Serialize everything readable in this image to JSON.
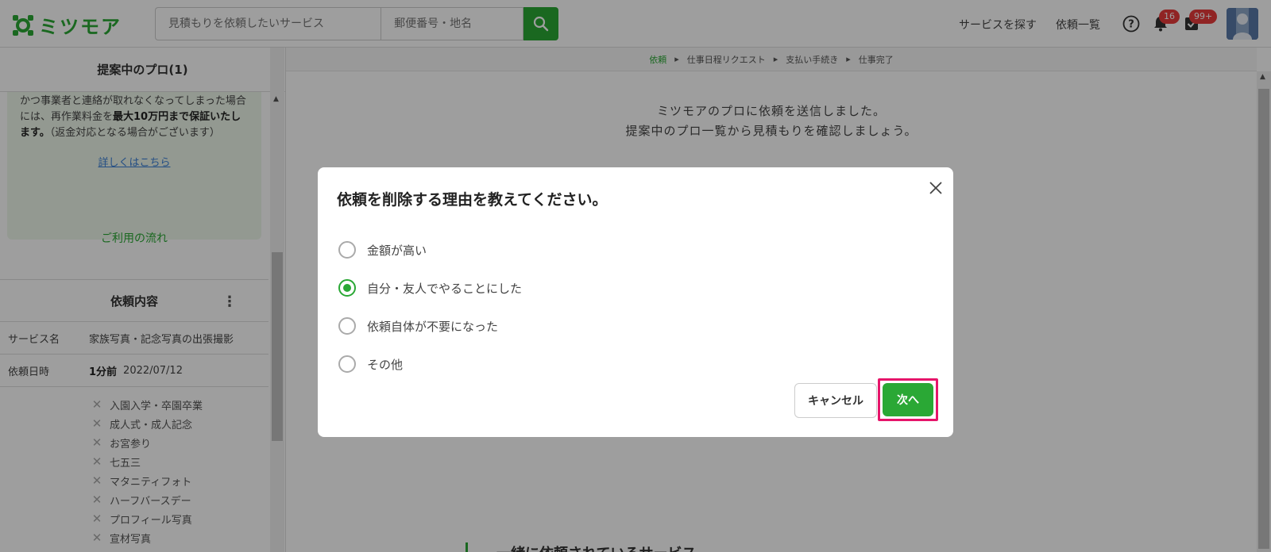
{
  "header": {
    "logo_text": "ミツモア",
    "search_placeholder": "見積もりを依頼したいサービス",
    "area_placeholder": "郵便番号・地名",
    "nav_find_services": "サービスを探す",
    "nav_requests": "依頼一覧",
    "notification_count": "16",
    "task_count": "99+"
  },
  "left": {
    "title": "提案中のプロ(1)",
    "guarantee_text_1": "かつ事業者と連絡が取れなくなってしまった場合には、再作業料金を",
    "guarantee_bold_1": "最大10万円まで保証いたします。",
    "guarantee_text_2": "（返金対応となる場合がございます）",
    "detail_link": "詳しくはこちら",
    "flow_link": "ご利用の流れ",
    "request_section_title": "依頼内容",
    "service_name_label": "サービス名",
    "service_name_value": "家族写真・記念写真の出張撮影",
    "request_date_label": "依頼日時",
    "request_date_relative": "1分前",
    "request_date_value": "2022/07/12",
    "tags": [
      "入園入学・卒園卒業",
      "成人式・成人記念",
      "お宮参り",
      "七五三",
      "マタニティフォト",
      "ハーフバースデー",
      "プロフィール写真",
      "宣材写真"
    ]
  },
  "main": {
    "breadcrumb": [
      "依頼",
      "仕事日程リクエスト",
      "支払い手続き",
      "仕事完了"
    ],
    "sent_line_1": "ミツモアのプロに依頼を送信しました。",
    "sent_line_2": "提案中のプロ一覧から見積もりを確認しましょう。",
    "bottom_heading": "一緒に依頼されているサービス"
  },
  "modal": {
    "title": "依頼を削除する理由を教えてください。",
    "options": [
      "金額が高い",
      "自分・友人でやることにした",
      "依頼自体が不要になった",
      "その他"
    ],
    "selected_index": 1,
    "cancel_label": "キャンセル",
    "next_label": "次へ"
  },
  "colors": {
    "brand_green": "#2aa835",
    "highlight_pink": "#e6156a",
    "badge_red": "#e83b3b"
  }
}
